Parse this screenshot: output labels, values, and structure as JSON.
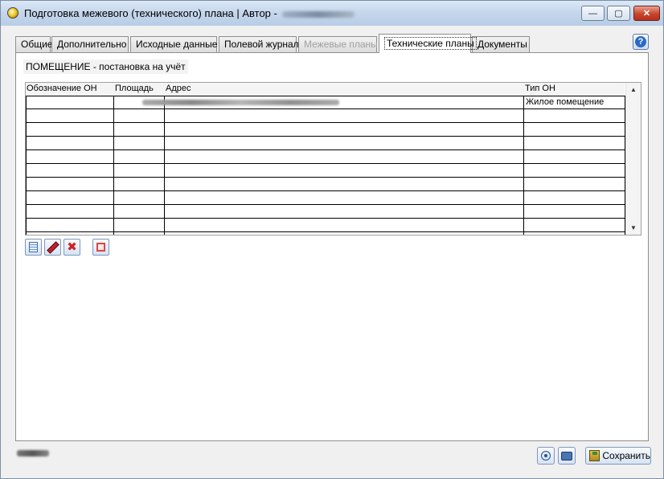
{
  "window": {
    "title": "Подготовка межевого (технического) плана | Автор -",
    "controls": {
      "minimize": "—",
      "maximize": "▢",
      "close": "✕"
    }
  },
  "tabs": [
    {
      "label": "Общие",
      "state": "normal"
    },
    {
      "label": "Дополнительно",
      "state": "normal"
    },
    {
      "label": "Исходные данные",
      "state": "normal"
    },
    {
      "label": "Полевой журнал",
      "state": "normal"
    },
    {
      "label": "Межевые планы",
      "state": "disabled"
    },
    {
      "label": "Технические планы",
      "state": "active"
    },
    {
      "label": "Документы",
      "state": "normal"
    }
  ],
  "help": {
    "icon": "help-icon",
    "label": "?"
  },
  "section": {
    "title": "ПОМЕЩЕНИЕ - постановка на учёт"
  },
  "grid": {
    "columns": [
      "Обозначение ОН",
      "Площадь",
      "Адрес",
      "Тип ОН"
    ],
    "rows": [
      {
        "designation": "",
        "area": "",
        "address": "",
        "type": "Жилое помещение"
      },
      {
        "designation": "",
        "area": "",
        "address": "",
        "type": ""
      },
      {
        "designation": "",
        "area": "",
        "address": "",
        "type": ""
      },
      {
        "designation": "",
        "area": "",
        "address": "",
        "type": ""
      },
      {
        "designation": "",
        "area": "",
        "address": "",
        "type": ""
      },
      {
        "designation": "",
        "area": "",
        "address": "",
        "type": ""
      },
      {
        "designation": "",
        "area": "",
        "address": "",
        "type": ""
      },
      {
        "designation": "",
        "area": "",
        "address": "",
        "type": ""
      },
      {
        "designation": "",
        "area": "",
        "address": "",
        "type": ""
      },
      {
        "designation": "",
        "area": "",
        "address": "",
        "type": ""
      }
    ],
    "scroll_up": "▲",
    "scroll_down": "▼"
  },
  "toolbar": {
    "buttons": [
      "add-record-icon",
      "edit-record-icon",
      "delete-record-icon",
      "stop-icon"
    ],
    "delete_glyph": "✖"
  },
  "footer": {
    "save_label": "Сохранить"
  },
  "colors": {
    "titlebar": "#c4d6ec",
    "close_button": "#c8452c",
    "tab_active_bg": "#ffffff",
    "panel_bg": "#ffffff",
    "window_bg": "#f0f0f0"
  }
}
